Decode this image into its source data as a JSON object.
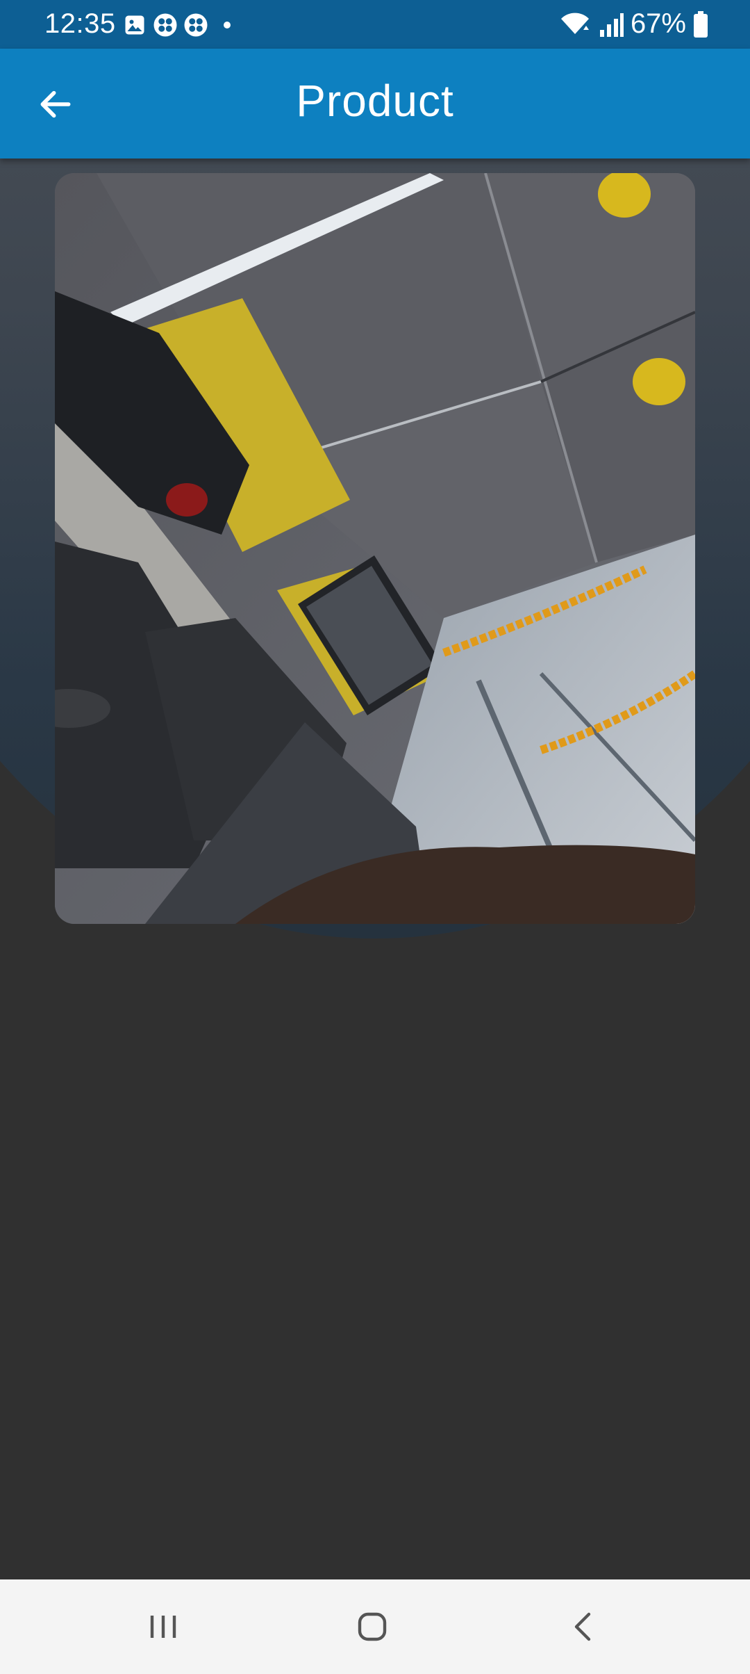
{
  "status_bar": {
    "time": "12:35",
    "battery": "67%",
    "left_icons": [
      "image-icon",
      "app-grid-icon",
      "app-grid-icon",
      "notification-dot"
    ],
    "right_icons": [
      "wifi-icon",
      "signal-icon",
      "battery-icon"
    ]
  },
  "app_bar": {
    "title": "Product",
    "back_icon": "arrow-left-icon",
    "color": "#0d80c0"
  },
  "product": {
    "image_subject": "photo-of-office-ceiling"
  },
  "nav_bar": {
    "buttons": [
      "recent-apps-icon",
      "home-icon",
      "back-icon"
    ]
  },
  "colors": {
    "status_bar": "#0d5f94",
    "app_bar": "#0d80c0",
    "background": "#303030",
    "nav_bar": "#f4f4f4"
  }
}
